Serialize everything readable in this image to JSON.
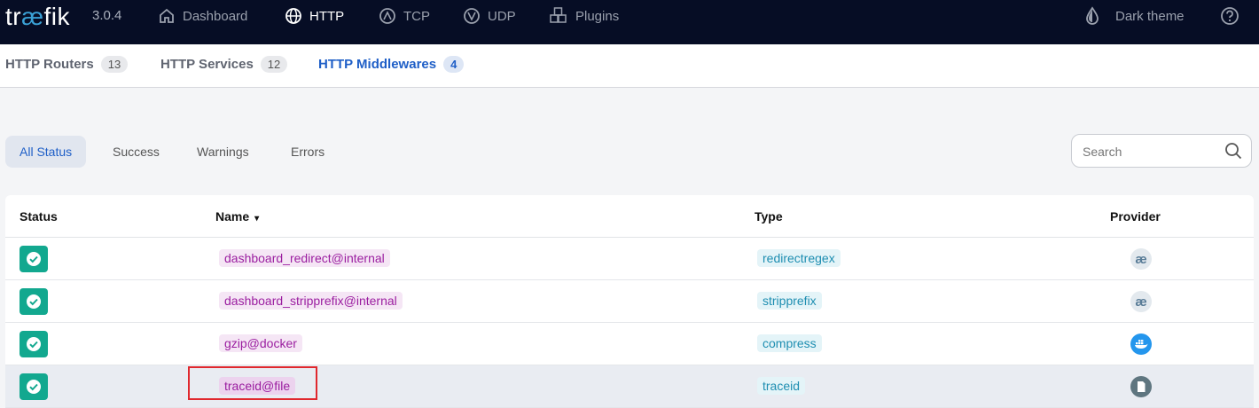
{
  "topbar": {
    "logo_prefix": "tr",
    "logo_ae": "æ",
    "logo_suffix": "fik",
    "version": "3.0.4",
    "nav": [
      {
        "label": "Dashboard",
        "icon": "home-icon"
      },
      {
        "label": "HTTP",
        "icon": "globe-icon"
      },
      {
        "label": "TCP",
        "icon": "tcp-icon"
      },
      {
        "label": "UDP",
        "icon": "udp-icon"
      },
      {
        "label": "Plugins",
        "icon": "plugins-icon"
      }
    ],
    "active_nav": "HTTP",
    "theme_label": "Dark theme"
  },
  "subtabs": [
    {
      "label": "HTTP Routers",
      "count": "13"
    },
    {
      "label": "HTTP Services",
      "count": "12"
    },
    {
      "label": "HTTP Middlewares",
      "count": "4"
    }
  ],
  "active_subtab": "HTTP Middlewares",
  "filters": [
    "All Status",
    "Success",
    "Warnings",
    "Errors"
  ],
  "active_filter": "All Status",
  "search": {
    "placeholder": "Search",
    "value": ""
  },
  "table": {
    "columns": [
      "Status",
      "Name",
      "Type",
      "Provider"
    ],
    "sort_indicator": "▾",
    "rows": [
      {
        "status": "success",
        "name": "dashboard_redirect@internal",
        "type": "redirectregex",
        "provider": "internal"
      },
      {
        "status": "success",
        "name": "dashboard_stripprefix@internal",
        "type": "stripprefix",
        "provider": "internal"
      },
      {
        "status": "success",
        "name": "gzip@docker",
        "type": "compress",
        "provider": "docker"
      },
      {
        "status": "success",
        "name": "traceid@file",
        "type": "traceid",
        "provider": "file"
      }
    ]
  },
  "colors": {
    "topbar_bg": "#060d25",
    "accent": "#1f5fc7",
    "success": "#12a88f",
    "name_chip": "#9b1ea0",
    "type_chip": "#1e8eb1",
    "annotation_box": "#e0282e"
  }
}
